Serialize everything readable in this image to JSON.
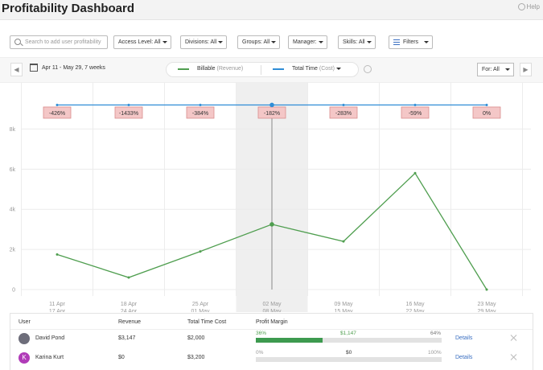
{
  "header": {
    "title": "Profitability Dashboard",
    "help_label": "Help"
  },
  "filters": {
    "search_placeholder": "Search to add user profitability",
    "access_level": "Access Level: All",
    "divisions": "Divisions: All",
    "groups": "Groups: All",
    "manager": "Manager:",
    "skills": "Skills: All",
    "filters_label": "Filters"
  },
  "chart_toolbar": {
    "prev": "◀",
    "date_range": "Apr 11 - May 29, 7 weeks",
    "legend_billable": "Billable",
    "legend_billable_sub": "(Revenue)",
    "legend_total": "Total Time",
    "legend_total_sub": "(Cost)",
    "for_label": "For: All",
    "next": "▶"
  },
  "colors": {
    "revenue": "#4f9e4f",
    "cost": "#2f8dd6",
    "badge_bg": "#f4c7c7",
    "badge_border": "#d98c8c",
    "accent": "#3a6fc1"
  },
  "chart_data": {
    "type": "line",
    "categories": [
      [
        "11 Apr",
        "17 Apr"
      ],
      [
        "18 Apr",
        "24 Apr"
      ],
      [
        "25 Apr",
        "01 May"
      ],
      [
        "02 May",
        "08 May"
      ],
      [
        "09 May",
        "15 May"
      ],
      [
        "16 May",
        "22 May"
      ],
      [
        "23 May",
        "29 May"
      ]
    ],
    "series": [
      {
        "name": "Billable (Revenue)",
        "values": [
          1750,
          600,
          1900,
          3250,
          2400,
          5800,
          0
        ]
      },
      {
        "name": "Total Time (Cost)",
        "values": [
          9200,
          9200,
          9200,
          9200,
          9200,
          9200,
          9200
        ]
      }
    ],
    "margins": [
      "-426%",
      "-1433%",
      "-384%",
      "-182%",
      "-283%",
      "-59%",
      "0%"
    ],
    "y_ticks": [
      "0",
      "2k",
      "4k",
      "6k",
      "8k"
    ],
    "ylim": [
      0,
      9500
    ],
    "highlight_index": 3
  },
  "table": {
    "headers": {
      "user": "User",
      "revenue": "Revenue",
      "cost": "Total Time Cost",
      "margin": "Profit Margin"
    },
    "rows": [
      {
        "name": "David Pond",
        "initial": "",
        "revenue": "$3,147",
        "cost": "$2,000",
        "pct_left": "36%",
        "profit": "$1,147",
        "pct_right": "64%",
        "fill": 0.36,
        "details": "Details",
        "avatar_color": "#6d6d7a"
      },
      {
        "name": "Karina Kurt",
        "initial": "K",
        "revenue": "$0",
        "cost": "$3,200",
        "pct_left": "0%",
        "profit": "$0",
        "pct_right": "100%",
        "fill": 0,
        "details": "Details",
        "avatar_color": "#b03bb8"
      }
    ]
  }
}
